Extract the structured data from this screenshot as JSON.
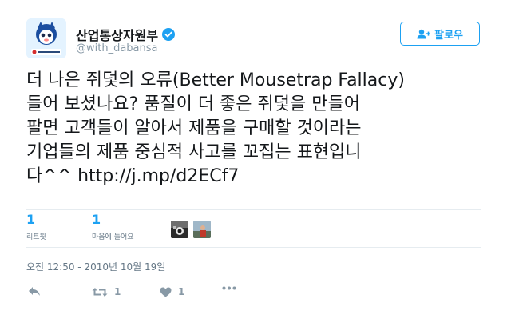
{
  "author": {
    "display_name": "산업통상자원부",
    "handle": "@with_dabansa",
    "avatar_icon": "ministry-mascot-logo"
  },
  "follow_button": {
    "label": "팔로우",
    "icon": "add-user-icon"
  },
  "tweet": {
    "lines": [
      "더 나은 쥐덫의 오류(Better Mousetrap Fallacy)",
      "들어 보셨나요? 품질이 더 좋은 쥐덫을 만들어",
      "팔면 고객들이 알아서 제품을 구매할 것이라는",
      "기업들의 제품 중심적 사고를 꼬집는 표현입니"
    ],
    "last_line_text": "다^^ ",
    "link": "http://j.mp/d2ECf7"
  },
  "stats": {
    "retweets": {
      "count": "1",
      "label": "리트윗"
    },
    "likes": {
      "count": "1",
      "label": "마음에 들어요"
    }
  },
  "timestamp": "오전 12:50 - 2010년 10월 19일",
  "actions": {
    "reply_icon": "reply-icon",
    "retweet_icon": "retweet-icon",
    "retweet_count": "1",
    "like_icon": "heart-icon",
    "like_count": "1",
    "more_icon": "more-icon"
  },
  "colors": {
    "accent": "#1da1f2",
    "text": "#14171a",
    "muted": "#657786",
    "icon": "#8899a6"
  }
}
